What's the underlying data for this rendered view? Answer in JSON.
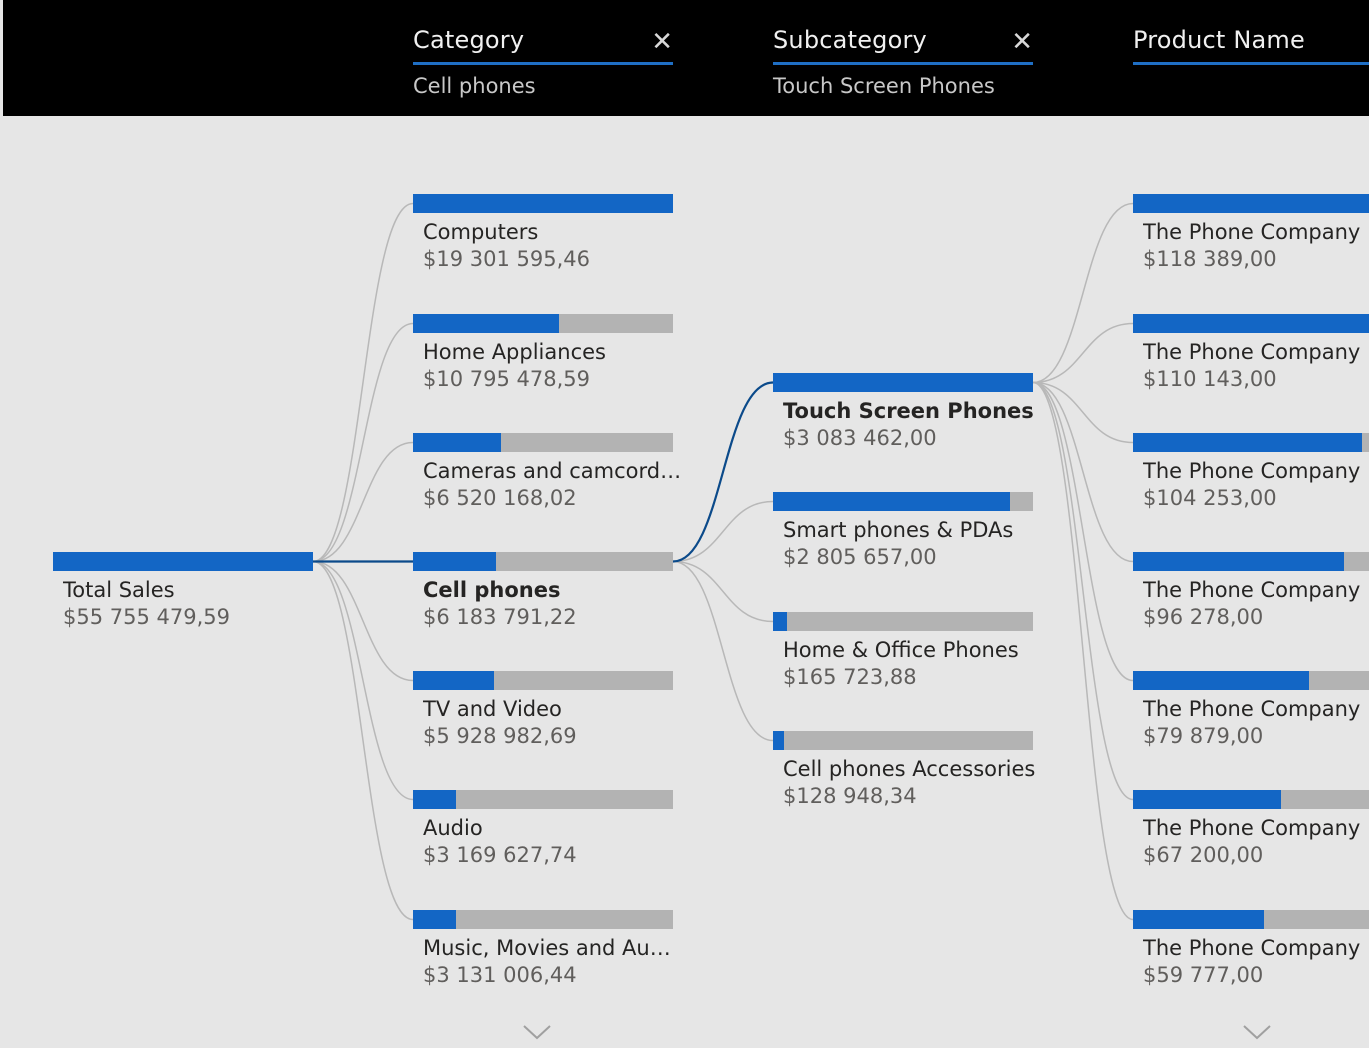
{
  "header": {
    "columns": [
      {
        "title": "Category",
        "value": "Cell phones",
        "close": "✕"
      },
      {
        "title": "Subcategory",
        "value": "Touch Screen Phones",
        "close": "✕"
      },
      {
        "title": "Product Name",
        "value": ""
      }
    ]
  },
  "root": {
    "label": "Total Sales",
    "value": "$55 755 479,59",
    "fill": 1.0
  },
  "categories": [
    {
      "label": "Computers",
      "value": "$19 301 595,46",
      "fill": 1.0
    },
    {
      "label": "Home Appliances",
      "value": "$10 795 478,59",
      "fill": 0.56
    },
    {
      "label": "Cameras and camcord…",
      "value": "$6 520 168,02",
      "fill": 0.34
    },
    {
      "label": "Cell phones",
      "value": "$6 183 791,22",
      "fill": 0.32,
      "selected": true
    },
    {
      "label": "TV and Video",
      "value": "$5 928 982,69",
      "fill": 0.31
    },
    {
      "label": "Audio",
      "value": "$3 169 627,74",
      "fill": 0.165
    },
    {
      "label": "Music, Movies and Au…",
      "value": "$3 131 006,44",
      "fill": 0.165
    }
  ],
  "subcategories": [
    {
      "label": "Touch Screen Phones",
      "value": "$3 083 462,00",
      "fill": 1.0,
      "selected": true
    },
    {
      "label": "Smart phones & PDAs",
      "value": "$2 805 657,00",
      "fill": 0.91
    },
    {
      "label": "Home & Office Phones",
      "value": "$165 723,88",
      "fill": 0.054
    },
    {
      "label": "Cell phones Accessories",
      "value": "$128 948,34",
      "fill": 0.042
    }
  ],
  "products": [
    {
      "label": "The Phone Company",
      "value": "$118 389,00",
      "fill": 1.0
    },
    {
      "label": "The Phone Company",
      "value": "$110 143,00",
      "fill": 0.93
    },
    {
      "label": "The Phone Company",
      "value": "$104 253,00",
      "fill": 0.88
    },
    {
      "label": "The Phone Company",
      "value": "$96 278,00",
      "fill": 0.81
    },
    {
      "label": "The Phone Company",
      "value": "$79 879,00",
      "fill": 0.675
    },
    {
      "label": "The Phone Company",
      "value": "$67 200,00",
      "fill": 0.568
    },
    {
      "label": "The Phone Company",
      "value": "$59 777,00",
      "fill": 0.505
    }
  ],
  "colors": {
    "bar_fill": "#1366c5",
    "bar_track": "#b3b3b3",
    "link": "#b8b8b8",
    "link_selected": "#0b4a8a",
    "header_bg": "#000000",
    "header_accent": "#1f6fc5"
  },
  "icons": {
    "more": "chevron-down-icon",
    "remove": "close-icon"
  }
}
